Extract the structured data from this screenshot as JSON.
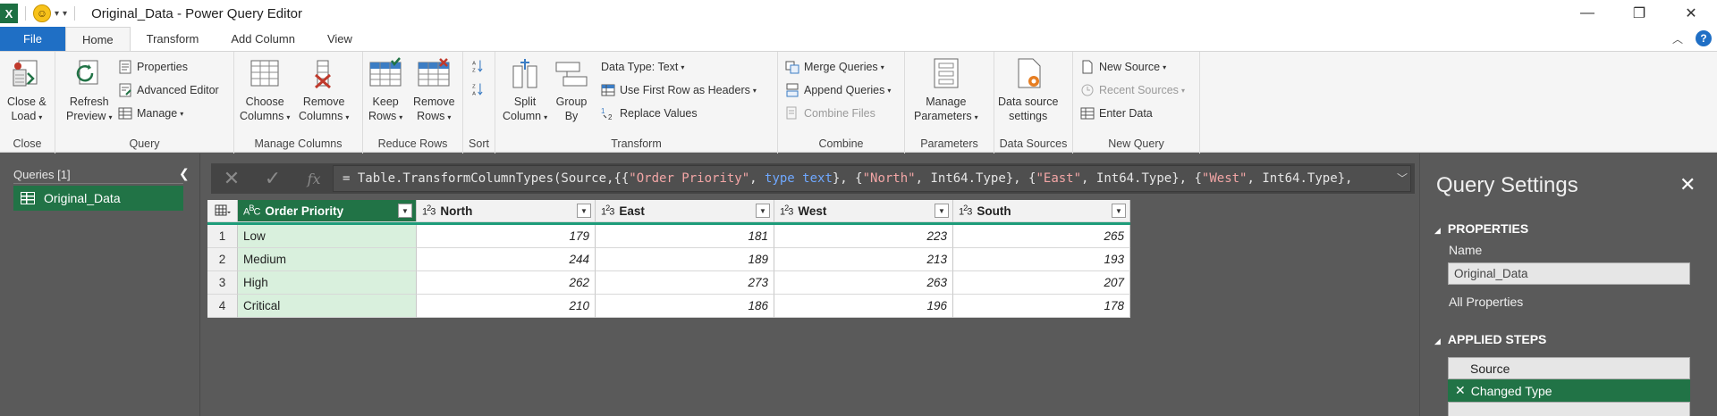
{
  "window": {
    "title": "Original_Data - Power Query Editor",
    "app_icon": "X"
  },
  "tabs": [
    "File",
    "Home",
    "Transform",
    "Add Column",
    "View"
  ],
  "ribbon": {
    "close": {
      "label1": "Close &",
      "label2": "Load",
      "group": "Close"
    },
    "query": {
      "refresh1": "Refresh",
      "refresh2": "Preview",
      "properties": "Properties",
      "advanced": "Advanced Editor",
      "manage": "Manage",
      "group": "Query"
    },
    "manage_columns": {
      "choose1": "Choose",
      "choose2": "Columns",
      "remove1": "Remove",
      "remove2": "Columns",
      "group": "Manage Columns"
    },
    "reduce_rows": {
      "keep1": "Keep",
      "keep2": "Rows",
      "remove1": "Remove",
      "remove2": "Rows",
      "group": "Reduce Rows"
    },
    "sort": {
      "group": "Sort"
    },
    "transform": {
      "split1": "Split",
      "split2": "Column",
      "group1": "Group",
      "group2": "By",
      "datatype": "Data Type: Text",
      "firstrow": "Use First Row as Headers",
      "replace": "Replace Values",
      "group": "Transform"
    },
    "combine": {
      "merge": "Merge Queries",
      "append": "Append Queries",
      "combine_files": "Combine Files",
      "group": "Combine"
    },
    "parameters": {
      "manage1": "Manage",
      "manage2": "Parameters",
      "group": "Parameters"
    },
    "data_sources": {
      "label1": "Data source",
      "label2": "settings",
      "group": "Data Sources"
    },
    "new_query": {
      "new_source": "New Source",
      "recent": "Recent Sources",
      "enter": "Enter Data",
      "group": "New Query"
    }
  },
  "queries": {
    "header": "Queries [1]",
    "items": [
      "Original_Data"
    ]
  },
  "formula": {
    "p1": "= Table.TransformColumnTypes(Source,{{",
    "s1": "\"Order Priority\"",
    "p2": ", ",
    "k1": "type text",
    "p3": "}, {",
    "s2": "\"North\"",
    "p4": ", Int64.Type}, {",
    "s3": "\"East\"",
    "p5": ", Int64.Type}, {",
    "s4": "\"West\"",
    "p6": ", Int64.Type},"
  },
  "table": {
    "columns": [
      {
        "name": "Order Priority",
        "type": "ABC"
      },
      {
        "name": "North",
        "type": "123"
      },
      {
        "name": "East",
        "type": "123"
      },
      {
        "name": "West",
        "type": "123"
      },
      {
        "name": "South",
        "type": "123"
      }
    ],
    "rows": [
      {
        "n": "1",
        "c": [
          "Low",
          "179",
          "181",
          "223",
          "265"
        ]
      },
      {
        "n": "2",
        "c": [
          "Medium",
          "244",
          "189",
          "213",
          "193"
        ]
      },
      {
        "n": "3",
        "c": [
          "High",
          "262",
          "273",
          "263",
          "207"
        ]
      },
      {
        "n": "4",
        "c": [
          "Critical",
          "210",
          "186",
          "196",
          "178"
        ]
      }
    ]
  },
  "settings": {
    "title": "Query Settings",
    "properties": "PROPERTIES",
    "name_label": "Name",
    "name_value": "Original_Data",
    "all_properties": "All Properties",
    "applied_steps": "APPLIED STEPS",
    "steps": [
      "Source",
      "Changed Type"
    ]
  },
  "colors": {
    "excel_green": "#217346",
    "file_blue": "#1f6fc5",
    "canvas_grey": "#5a5a5a"
  }
}
